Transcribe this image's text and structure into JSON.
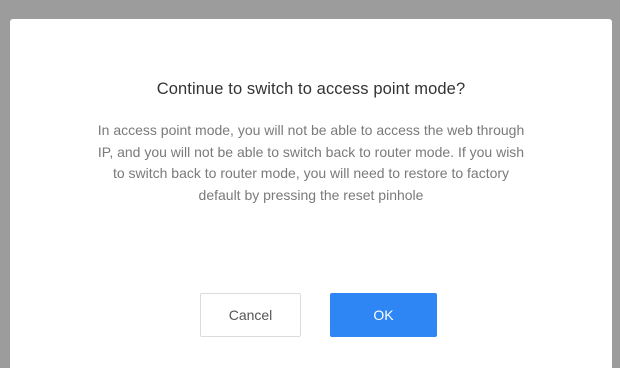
{
  "dialog": {
    "title": "Continue to switch to access point mode?",
    "message": "In access point mode, you will not be able to access the web through IP, and you will not be able to switch back to router mode. If you wish to switch back to router mode, you will need to restore to factory default by pressing the reset pinhole",
    "cancel_label": "Cancel",
    "ok_label": "OK"
  },
  "colors": {
    "overlay": "#9c9c9c",
    "primary": "#2e86f5"
  }
}
